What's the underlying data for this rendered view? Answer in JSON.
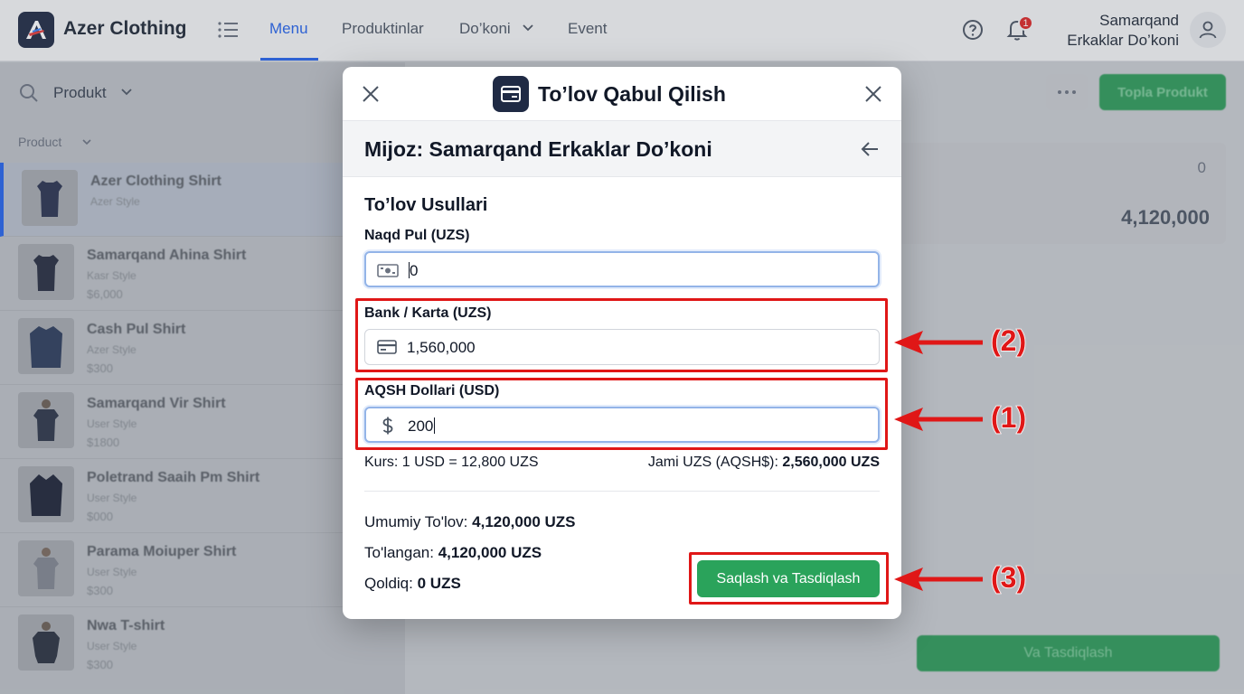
{
  "app": {
    "name": "Azer Clothing",
    "nav": [
      "Menu",
      "Produktinlar",
      "Do’koni",
      "Event"
    ],
    "notifications_count": "1",
    "store_line1": "Samarqand",
    "store_line2": "Erkaklar Do’koni"
  },
  "background": {
    "filter_label": "Produkt",
    "column_header": "Product",
    "add_button": "Topla Produkt",
    "summary_zero": "0",
    "summary_total": "4,120,000",
    "confirm_button": "Va Tasdiqlash",
    "products": [
      {
        "name": "Azer Clothing Shirt",
        "sub": "Azer Style",
        "price": ""
      },
      {
        "name": "Samarqand Ahina Shirt",
        "sub": "Kasr Style",
        "price": "$6,000"
      },
      {
        "name": "Cash Pul Shirt",
        "sub": "Azer Style",
        "price": "$300"
      },
      {
        "name": "Samarqand Vir Shirt",
        "sub": "User Style",
        "price": "$1800"
      },
      {
        "name": "Poletrand Saaih Pm Shirt",
        "sub": "User Style",
        "price": "$000"
      },
      {
        "name": "Parama Moiuper Shirt",
        "sub": "User Style",
        "price": "$300"
      },
      {
        "name": "Nwa T-shirt",
        "sub": "User Style",
        "price": "$300"
      }
    ]
  },
  "modal": {
    "title": "To’lov Qabul Qilish",
    "customer": "Mijoz: Samarqand Erkaklar Do’koni",
    "section_title": "To’lov Usullari",
    "cash": {
      "label": "Naqd Pul (UZS)",
      "value": "0"
    },
    "bank": {
      "label": "Bank / Karta (UZS)",
      "value": "1,560,000"
    },
    "usd": {
      "label": "AQSH Dollari (USD)",
      "value": "200"
    },
    "rate_text": "Kurs: 1 USD = 12,800 UZS",
    "jami_label": "Jami UZS (AQSH$):",
    "jami_value": "2,560,000 UZS",
    "total_label": "Umumiy To'lov:",
    "total_value": "4,120,000 UZS",
    "paid_label": "To'langan:",
    "paid_value": "4,120,000 UZS",
    "remaining_label": "Qoldiq:",
    "remaining_value": "0 UZS",
    "save_button": "Saqlash va Tasdiqlash"
  },
  "callouts": {
    "one": "(1)",
    "two": "(2)",
    "three": "(3)"
  },
  "colors": {
    "accent": "#2563eb",
    "success": "#2aa35b",
    "annotation": "#e01717",
    "brand_dark": "#1f2a44"
  },
  "icons": [
    "menu-icon",
    "help-icon",
    "bell-icon",
    "user-icon",
    "search-icon",
    "close-icon",
    "wallet-icon",
    "back-arrow-icon",
    "cash-icon",
    "card-icon",
    "dollar-icon"
  ]
}
